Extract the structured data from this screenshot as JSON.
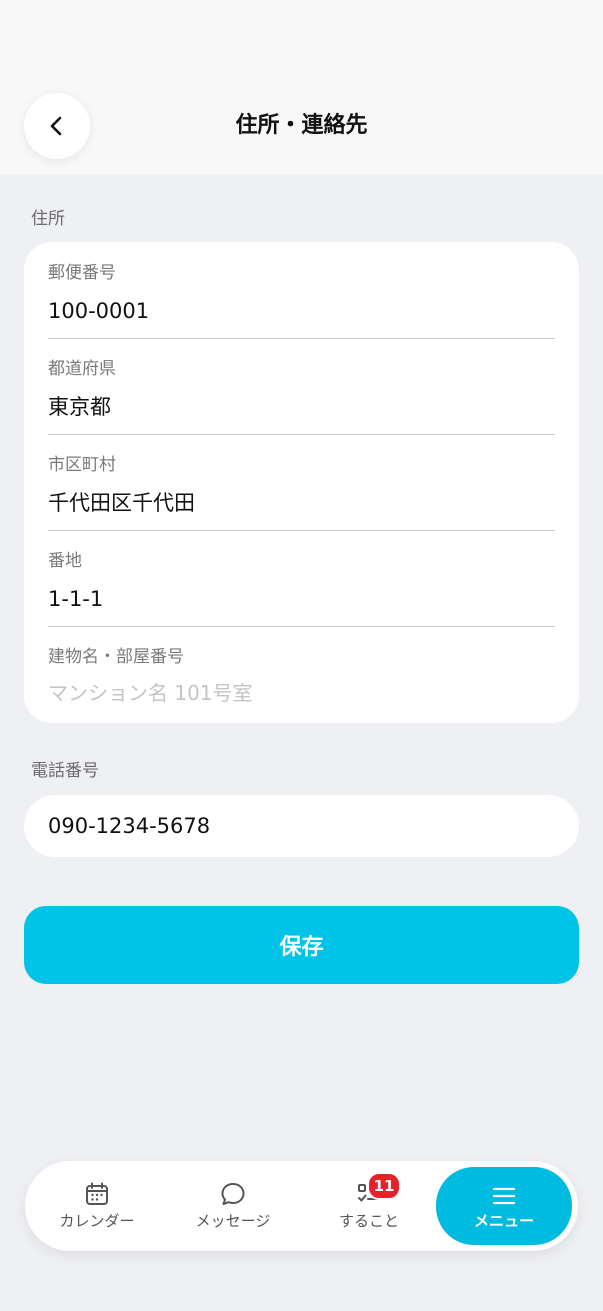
{
  "header": {
    "title": "住所・連絡先",
    "back_icon": "chevron-left-icon"
  },
  "address": {
    "section_label": "住所",
    "fields": [
      {
        "label": "郵便番号",
        "value": "100-0001"
      },
      {
        "label": "都道府県",
        "value": "東京都"
      },
      {
        "label": "市区町村",
        "value": "千代田区千代田"
      },
      {
        "label": "番地",
        "value": "1-1-1"
      },
      {
        "label": "建物名・部屋番号",
        "value": "",
        "placeholder": "マンション名 101号室"
      }
    ]
  },
  "phone": {
    "section_label": "電話番号",
    "value": "090-1234-5678"
  },
  "save_button": {
    "label": "保存"
  },
  "bottom_nav": {
    "items": [
      {
        "label": "カレンダー",
        "icon": "calendar-icon"
      },
      {
        "label": "メッセージ",
        "icon": "chat-bubble-icon"
      },
      {
        "label": "すること",
        "icon": "checklist-icon",
        "badge": "11"
      },
      {
        "label": "メニュー",
        "icon": "menu-icon",
        "active": true
      }
    ]
  },
  "colors": {
    "accent": "#00c3e8",
    "badge": "#e9202a",
    "background": "#eff0f4"
  }
}
